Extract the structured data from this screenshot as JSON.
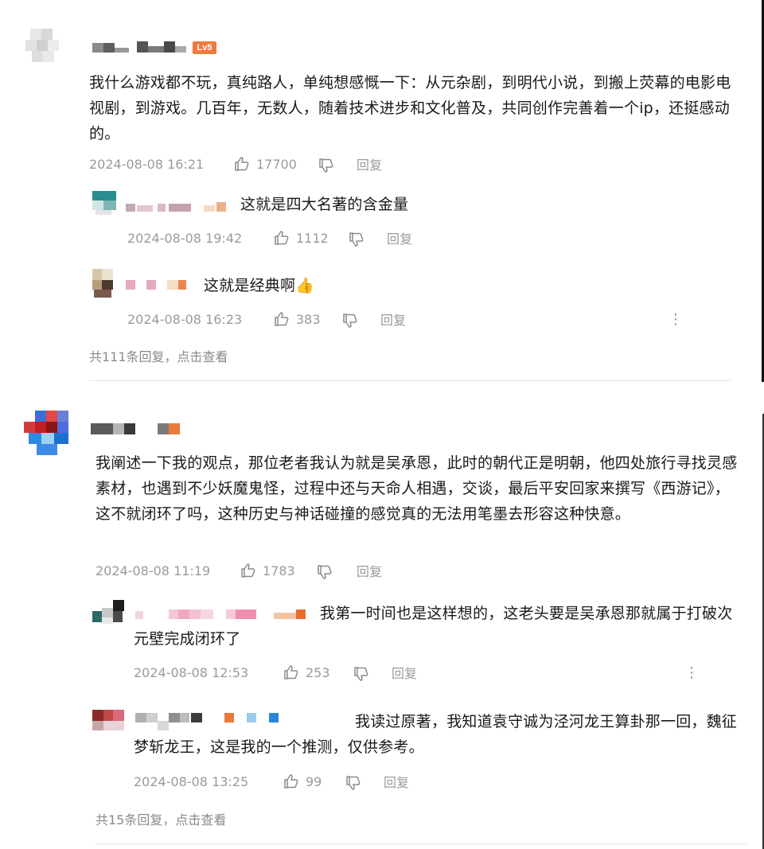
{
  "comments": [
    {
      "text": "我什么游戏都不玩，真纯路人，单纯想感慨一下：从元杂剧，到明代小说，到搬上荧幕的电影电视剧，到游戏。几百年，无数人，随着技术进步和文化普及，共同创作完善着一个ip，还挺感动的。",
      "badge": "Lv5",
      "time": "2024-08-08 16:21",
      "likes": "17700",
      "reply_label": "回复",
      "replies": [
        {
          "text": "这就是四大名著的含金量",
          "time": "2024-08-08 19:42",
          "likes": "1112",
          "reply_label": "回复"
        },
        {
          "text": "这就是经典啊👍",
          "time": "2024-08-08 16:23",
          "likes": "383",
          "reply_label": "回复"
        }
      ],
      "more_replies": "共111条回复，点击查看"
    },
    {
      "text": "我阐述一下我的观点，那位老者我认为就是吴承恩，此时的朝代正是明朝，他四处旅行寻找灵感素材，也遇到不少妖魔鬼怪，过程中还与天命人相遇，交谈，最后平安回家来撰写《西游记》，这不就闭环了吗，这种历史与神话碰撞的感觉真的无法用笔墨去形容这种快意。",
      "time": "2024-08-08 11:19",
      "likes": "1783",
      "reply_label": "回复",
      "replies": [
        {
          "text": "我第一时间也是这样想的，这老头要是吴承恩那就属于打破次元壁完成闭环了",
          "time": "2024-08-08 12:53",
          "likes": "253",
          "reply_label": "回复"
        },
        {
          "text": "我读过原著，我知道袁守诚为泾河龙王算卦那一回，魏征梦斩龙王，这是我的一个推测，仅供参考。",
          "time": "2024-08-08 13:25",
          "likes": "99",
          "reply_label": "回复"
        }
      ],
      "more_replies": "共15条回复，点击查看"
    }
  ],
  "colors": {
    "meta": "#9a9a9a",
    "text": "#1a1a1a",
    "badge": "#f07a3c",
    "divider": "#e6e6e6"
  }
}
